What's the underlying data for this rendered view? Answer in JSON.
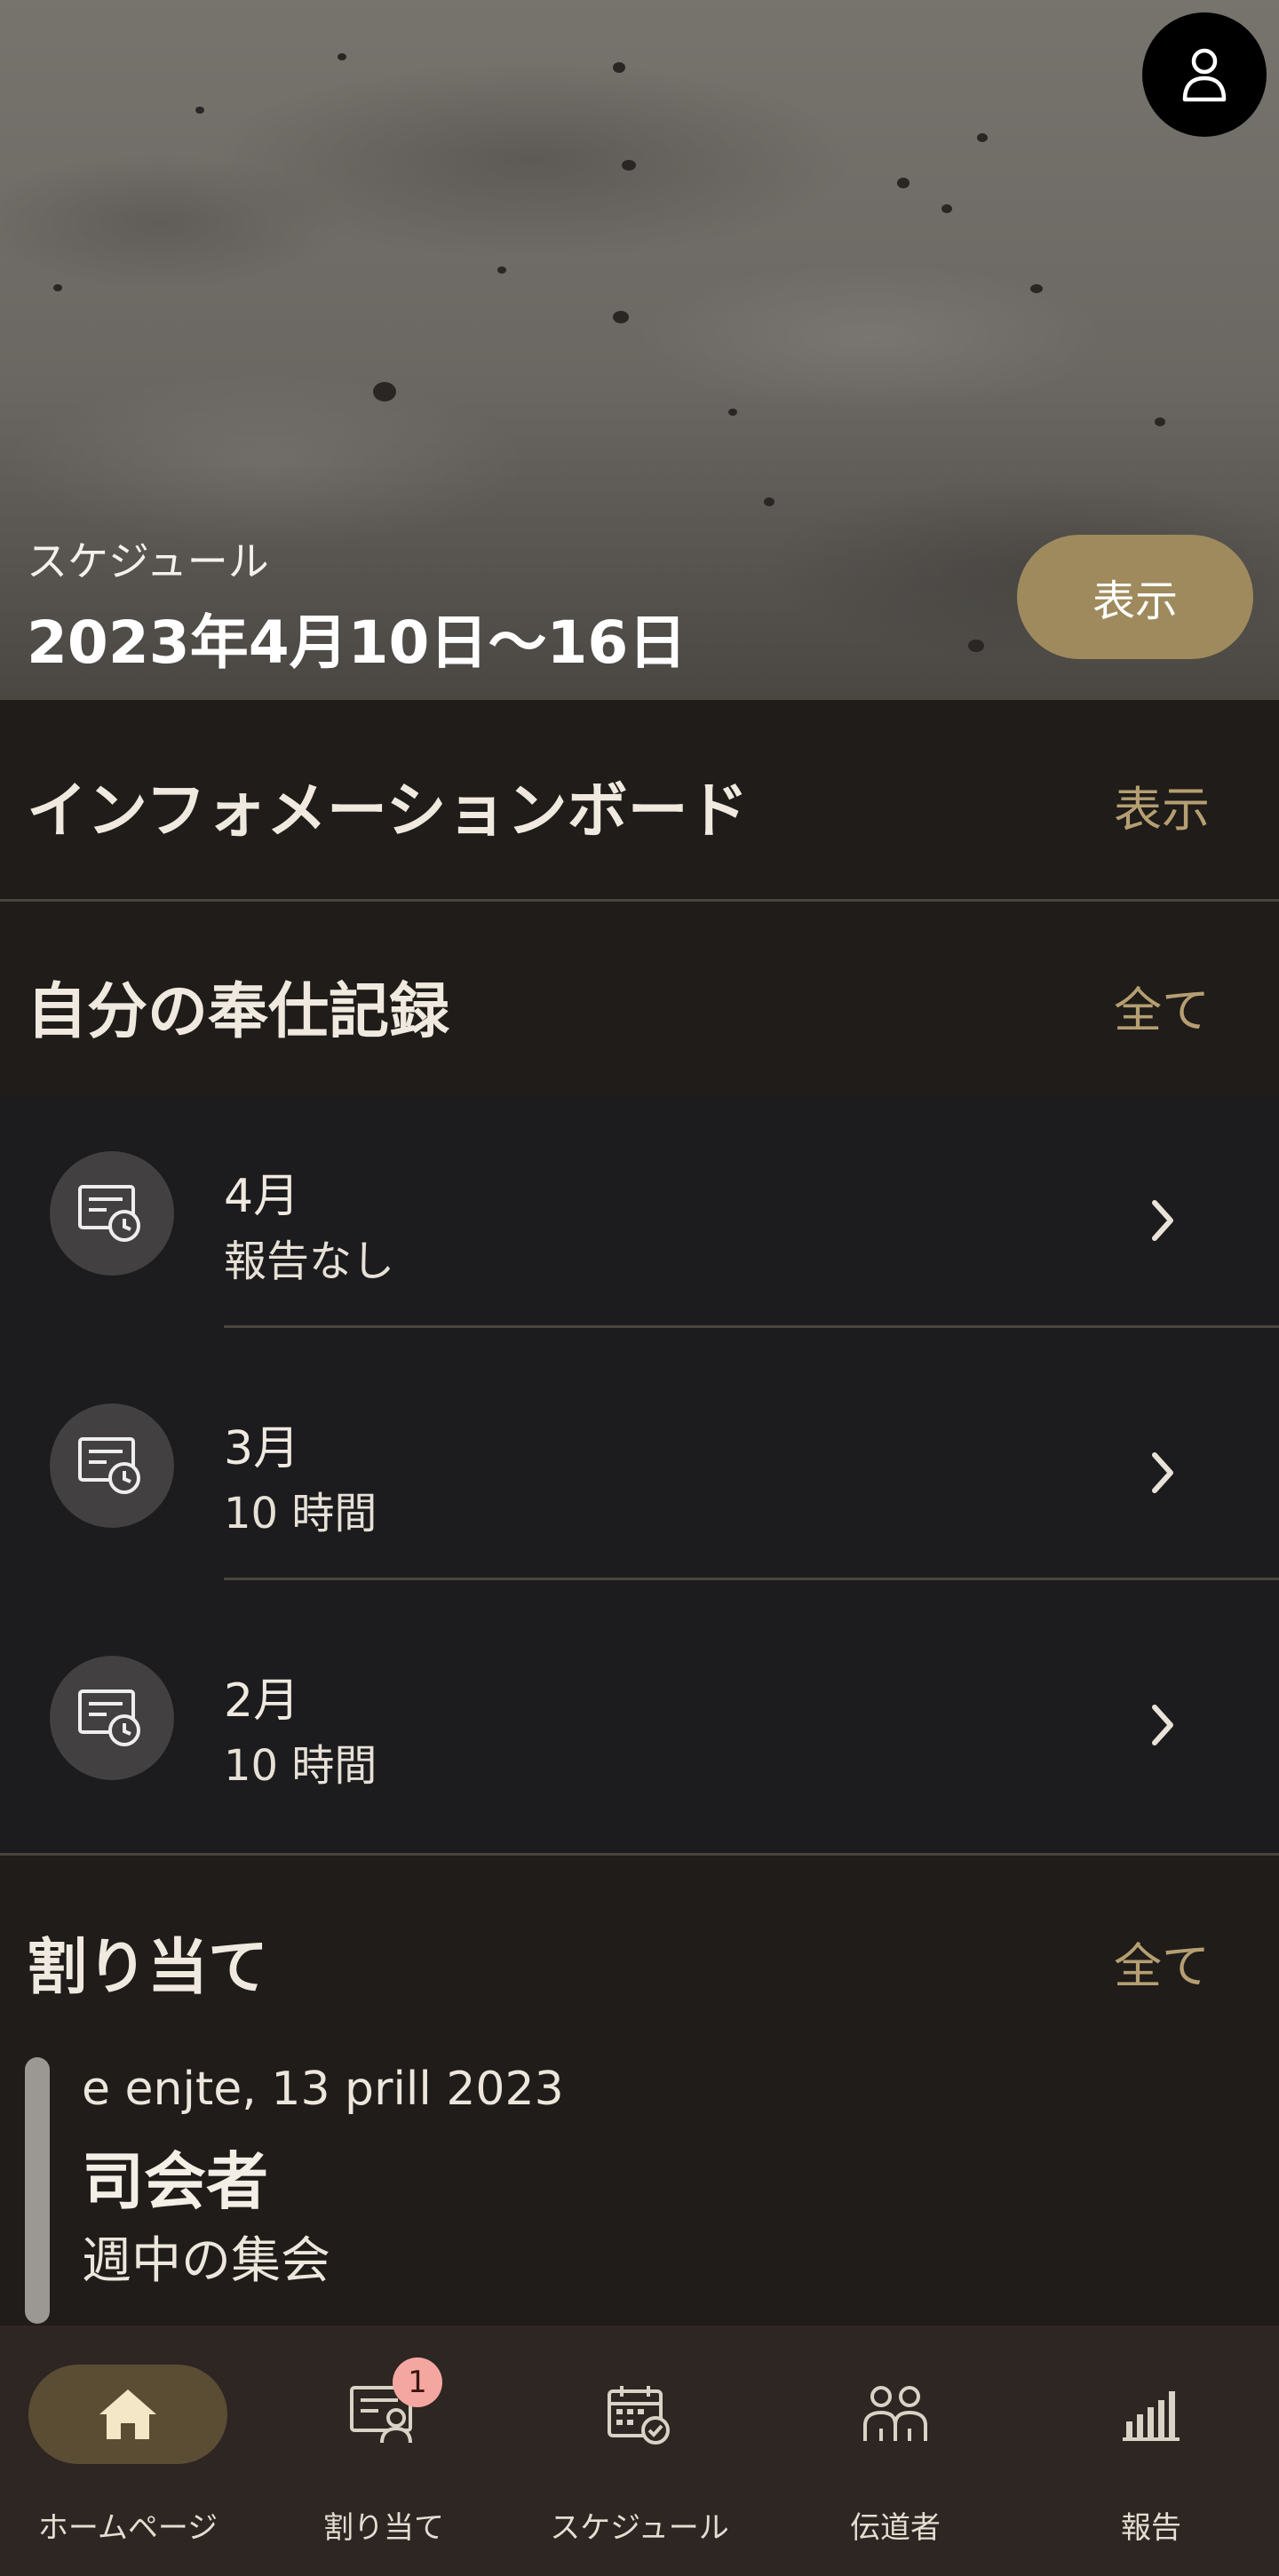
{
  "hero": {
    "subtitle": "スケジュール",
    "title": "2023年4月10日〜16日",
    "button_label": "表示",
    "avatar_icon": "user-icon"
  },
  "info_board": {
    "title": "インフォメーションボード",
    "link_label": "表示"
  },
  "service_records": {
    "title": "自分の奉仕記録",
    "link_label": "全て",
    "items": [
      {
        "month": "4月",
        "status": "報告なし",
        "icon": "report-clock-icon"
      },
      {
        "month": "3月",
        "status": "10 時間",
        "icon": "report-clock-icon"
      },
      {
        "month": "2月",
        "status": "10 時間",
        "icon": "report-clock-icon"
      }
    ]
  },
  "assignments": {
    "title": "割り当て",
    "link_label": "全て",
    "item": {
      "date": "e enjte, 13 prill 2023",
      "role": "司会者",
      "meeting": "週中の集会"
    }
  },
  "bottom_nav": {
    "items": [
      {
        "label": "ホームページ",
        "icon": "home-icon",
        "active": true
      },
      {
        "label": "割り当て",
        "icon": "assignment-icon",
        "badge": "1"
      },
      {
        "label": "スケジュール",
        "icon": "calendar-icon"
      },
      {
        "label": "伝道者",
        "icon": "people-icon"
      },
      {
        "label": "報告",
        "icon": "bar-chart-icon"
      }
    ]
  },
  "colors": {
    "background": "#1f1c19",
    "accent": "#b59f72",
    "button": "#9f8a5e",
    "nav_active": "#5a4d34",
    "badge": "#f4a7a0"
  }
}
